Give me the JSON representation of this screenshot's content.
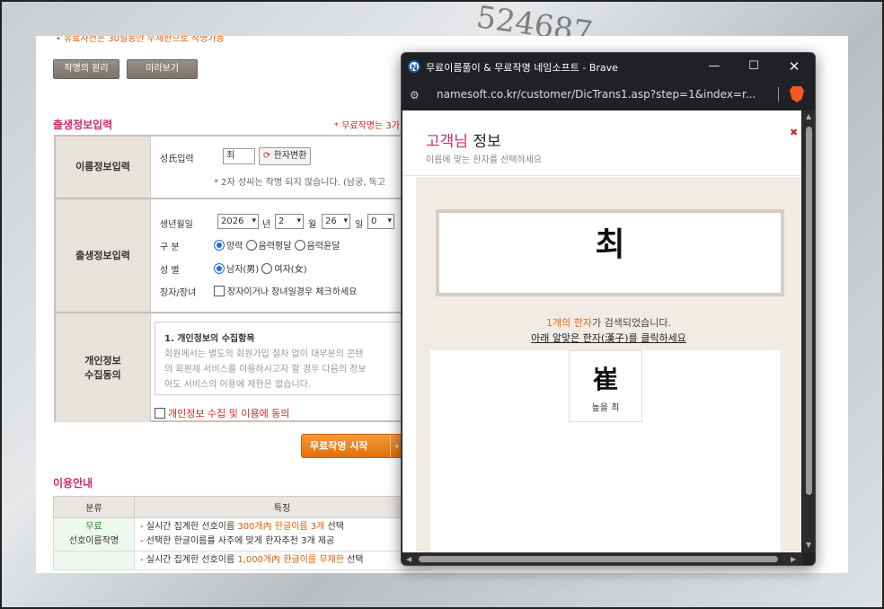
{
  "background": {
    "bg_number": "524687"
  },
  "main": {
    "top_note": "• 유료사전은 30일동안 무제한으로 작명가능",
    "buttons": {
      "principle": "작명의 원리",
      "preview": "미리보기"
    },
    "birth_section_title": "출생정보입력",
    "free_note": "* 무료작명는 3가",
    "rows": {
      "name_label": "이름정보입력",
      "birth_label": "출생정보입력",
      "privacy_label": "개인정보\n수집동의"
    },
    "name": {
      "surname_label": "성氏입력",
      "surname_value": "최",
      "hanja_button": "한자변환",
      "hint": "* 2자 성씨는 작명 되지 않습니다. (남궁, 독고"
    },
    "birth": {
      "date_label": "생년월일",
      "year": "2026",
      "year_unit": "년",
      "month": "2",
      "month_unit": "월",
      "day": "26",
      "day_unit": "일",
      "hour": "0",
      "calendar_label": "구 분",
      "calendar_options": [
        "양력",
        "음력평달",
        "음력윤달"
      ],
      "gender_label": "성 별",
      "gender_options": [
        "남자(男)",
        "여자(女)"
      ],
      "eldest_label": "장자/장녀",
      "eldest_text": "장자이거나 장녀일경우 체크하세요"
    },
    "privacy": {
      "heading": "1. 개인정보의 수집항목",
      "line1": "회원께서는 별도의 회원가입 절차 없이 대부분의 콘텐",
      "line2": "의 회원제 서비스를 이용하시고자 할 경우 다음의 정보",
      "line3": "아도 서비스의 이용에 제한은 없습니다.",
      "agree": "개인정보 수집 및 이용에 동의"
    },
    "start_button": "무료작명 시작",
    "usage_title": "이용안내",
    "table": {
      "headers": [
        "분류",
        "특징"
      ],
      "row1_cat1": "무료",
      "row1_cat2": "선호이름작명",
      "row1_line1_a": "- 실시간 집계한 선호이름 ",
      "row1_line1_b": "300개內 한글이름 3개",
      "row1_line1_c": " 선택",
      "row1_line2": "- 선택한 한글이름를 사주에 맞게 한자추천 3개 제공",
      "row2_line1_a": "- 실시간 집계한 선호이름 ",
      "row2_line1_b": "1,000개內 한글이름 무제한",
      "row2_line1_c": " 선택"
    }
  },
  "popup": {
    "window_title": "무료이름풀이 & 무료작명 네임소프트 - Brave",
    "url": "namesoft.co.kr/customer/DicTrans1.asp?step=1&index=r...",
    "title_pink": "고객님",
    "title_rest": " 정보",
    "subtitle": "이름에 맞는 한자를 선택하세요",
    "name_display": "최",
    "found_count": "1개의 한자",
    "found_rest": "가 검색되었습니다.",
    "instruction": "아래 알맞은 한자(漢子)를 클릭하세요",
    "hanja": [
      {
        "char": "崔",
        "meaning": "높을 최"
      }
    ]
  }
}
